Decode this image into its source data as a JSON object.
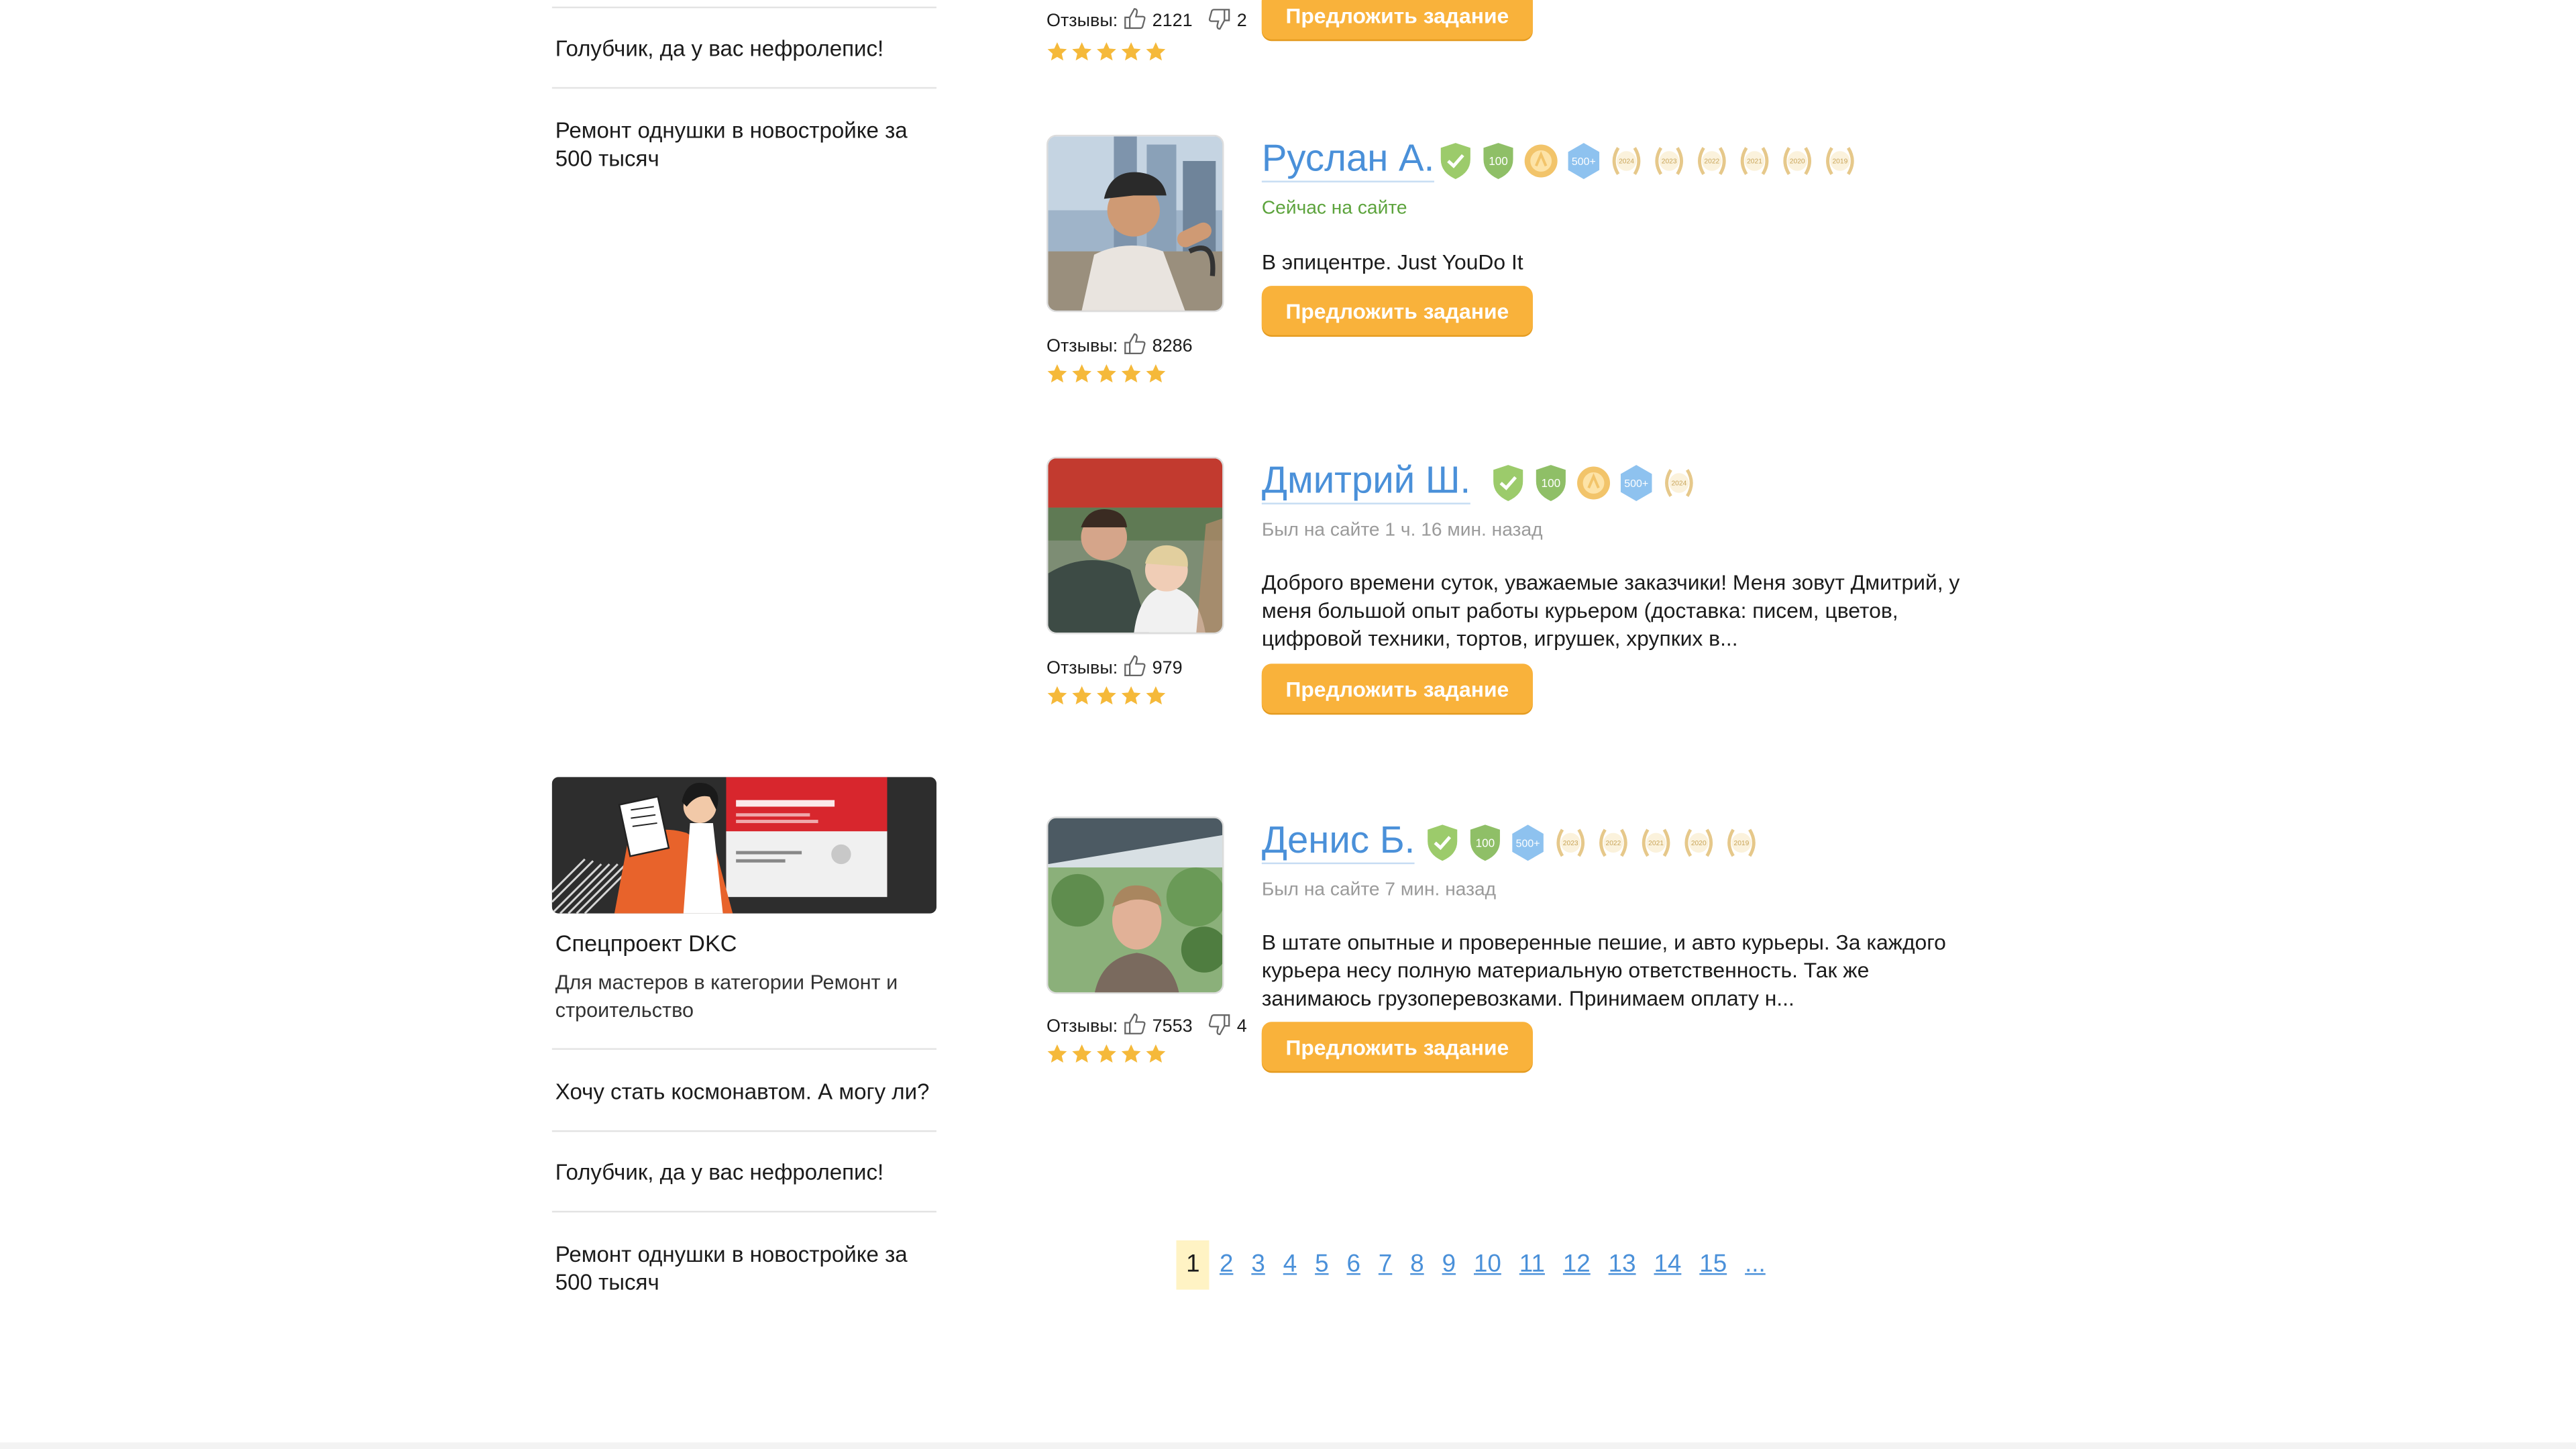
{
  "sidebar": {
    "links_top": [
      "Голубчик, да у вас нефролепис!",
      "Ремонт однушки в новостройке за 500 тысяч"
    ],
    "promo": {
      "title": "Спецпроект DKC",
      "description": "Для мастеров в категории Ремонт и строительство"
    },
    "links_bottom": [
      "Хочу стать космонавтом. А могу ли?",
      "Голубчик, да у вас нефролепис!",
      "Ремонт однушки в новостройке за 500 тысяч"
    ]
  },
  "performers": [
    {
      "reviews_label": "Отзывы:",
      "likes": "2121",
      "dislikes": "2",
      "rating_stars": 5,
      "offer_label": "Предложить задание"
    },
    {
      "name": "Руслан А.",
      "status": "Сейчас на сайте",
      "online": true,
      "description": "В эпицентре. Just YouDo It",
      "reviews_label": "Отзывы:",
      "likes": "8286",
      "rating_stars": 5,
      "offer_label": "Предложить задание",
      "badges": [
        "verified",
        "100",
        "award",
        "500+",
        "2024",
        "2023",
        "2022",
        "2021",
        "2020",
        "2019"
      ]
    },
    {
      "name": "Дмитрий Ш.",
      "status": "Был на сайте 1 ч. 16 мин. назад",
      "online": false,
      "description": "Доброго времени суток, уважаемые заказчики! Меня зовут Дмитрий, у меня большой опыт работы курьером (доставка: писем, цветов, цифровой техники, тортов, игрушек, хрупких в...",
      "reviews_label": "Отзывы:",
      "likes": "979",
      "rating_stars": 5,
      "offer_label": "Предложить задание",
      "badges": [
        "verified",
        "100",
        "award",
        "500+",
        "2024"
      ]
    },
    {
      "name": "Денис Б.",
      "status": "Был на сайте 7 мин. назад",
      "online": false,
      "description": "В штате опытные и проверенные пешие, и авто курьеры. За каждого курьера несу полную материальную ответственность. Так же занимаюсь грузоперевозками. Принимаем оплату н...",
      "reviews_label": "Отзывы:",
      "likes": "7553",
      "dislikes": "4",
      "rating_stars": 5,
      "offer_label": "Предложить задание",
      "badges": [
        "verified",
        "100",
        "500+",
        "2023",
        "2022",
        "2021",
        "2020",
        "2019"
      ]
    }
  ],
  "pagination": {
    "current": "1",
    "pages": [
      "2",
      "3",
      "4",
      "5",
      "6",
      "7",
      "8",
      "9",
      "10",
      "11",
      "12",
      "13",
      "14",
      "15"
    ],
    "more": "..."
  },
  "colors": {
    "accent_orange": "#f9b23b",
    "link_blue": "#4a90d9",
    "online_green": "#5ca33c",
    "star_gold": "#f5b93a"
  }
}
